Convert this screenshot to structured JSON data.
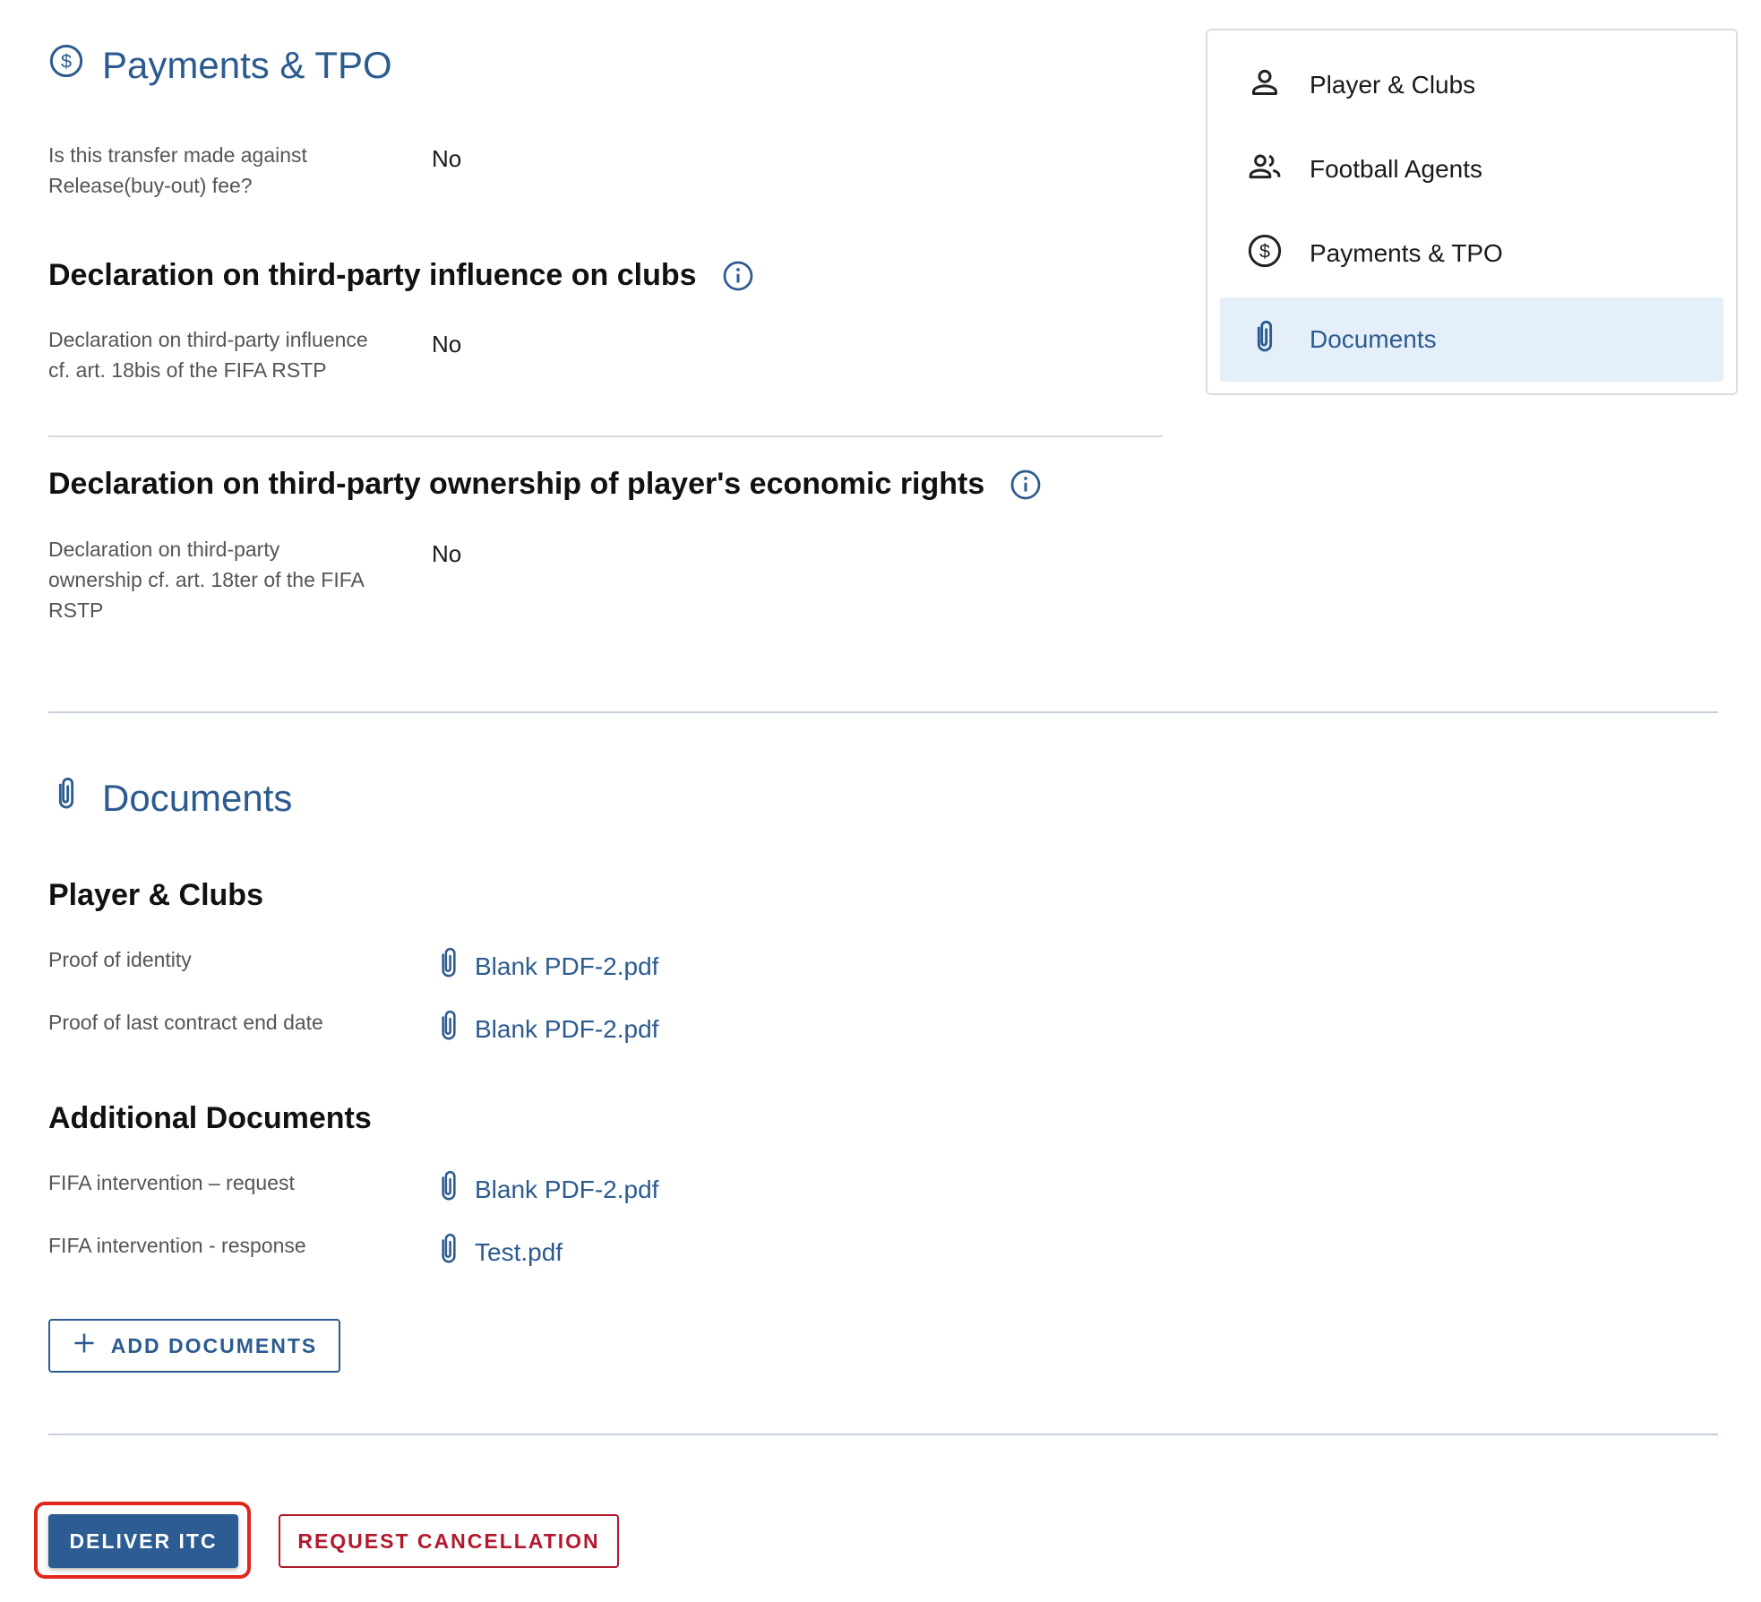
{
  "payments": {
    "title": "Payments & TPO",
    "buyout_label_1": "Is this transfer made against",
    "buyout_label_2": "Release(buy-out) fee?",
    "buyout_value": "No",
    "influence_heading": "Declaration on third-party influence on clubs",
    "influence_label_1": "Declaration on third-party influence",
    "influence_label_2": "cf. art. 18bis of the FIFA RSTP",
    "influence_value": "No",
    "ownership_heading": "Declaration on third-party ownership of player's economic rights",
    "ownership_label_1": "Declaration on third-party",
    "ownership_label_2": "ownership cf. art. 18ter of the FIFA",
    "ownership_label_3": "RSTP",
    "ownership_value": "No"
  },
  "documents": {
    "title": "Documents",
    "player_clubs_heading": "Player & Clubs",
    "additional_heading": "Additional Documents",
    "player_clubs_rows": [
      {
        "label": "Proof of identity",
        "file": "Blank PDF-2.pdf"
      },
      {
        "label": "Proof of last contract end date",
        "file": "Blank PDF-2.pdf"
      }
    ],
    "additional_rows": [
      {
        "label": "FIFA intervention – request",
        "file": "Blank PDF-2.pdf"
      },
      {
        "label": "FIFA intervention - response",
        "file": "Test.pdf"
      }
    ],
    "add_button": "ADD DOCUMENTS"
  },
  "actions": {
    "deliver": "DELIVER ITC",
    "cancel": "REQUEST CANCELLATION"
  },
  "nav": {
    "items": [
      {
        "label": "Player & Clubs",
        "icon": "person-icon"
      },
      {
        "label": "Football Agents",
        "icon": "people-icon"
      },
      {
        "label": "Payments & TPO",
        "icon": "dollar-circle-icon"
      },
      {
        "label": "Documents",
        "icon": "paperclip-icon",
        "active": true
      }
    ]
  },
  "colors": {
    "accent": "#2c5b8f",
    "active_nav_bg": "#e4eff9",
    "danger": "#b3192d",
    "highlight": "#e2261b"
  }
}
